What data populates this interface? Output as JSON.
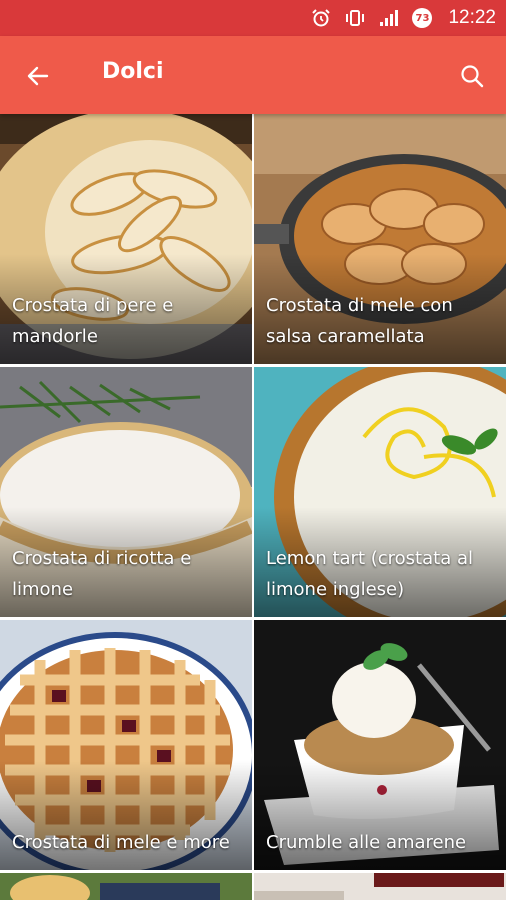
{
  "status_bar": {
    "time": "12:22",
    "badge": "73",
    "icons": [
      "alarm-icon",
      "vibrate-icon",
      "signal-icon",
      "badge-icon"
    ]
  },
  "app_bar": {
    "title": "Dolci",
    "back_icon": "arrow-back-icon",
    "search_icon": "search-icon",
    "color": "#ef5a4a",
    "status_color": "#d9393a"
  },
  "recipes": [
    {
      "title": "Crostata di pere e mandorle"
    },
    {
      "title": "Crostata di mele con salsa caramellata"
    },
    {
      "title": "Crostata di ricotta e limone"
    },
    {
      "title": "Lemon tart (crostata al limone inglese)"
    },
    {
      "title": "Crostata di mele e more"
    },
    {
      "title": "Crumble alle amarene"
    }
  ]
}
